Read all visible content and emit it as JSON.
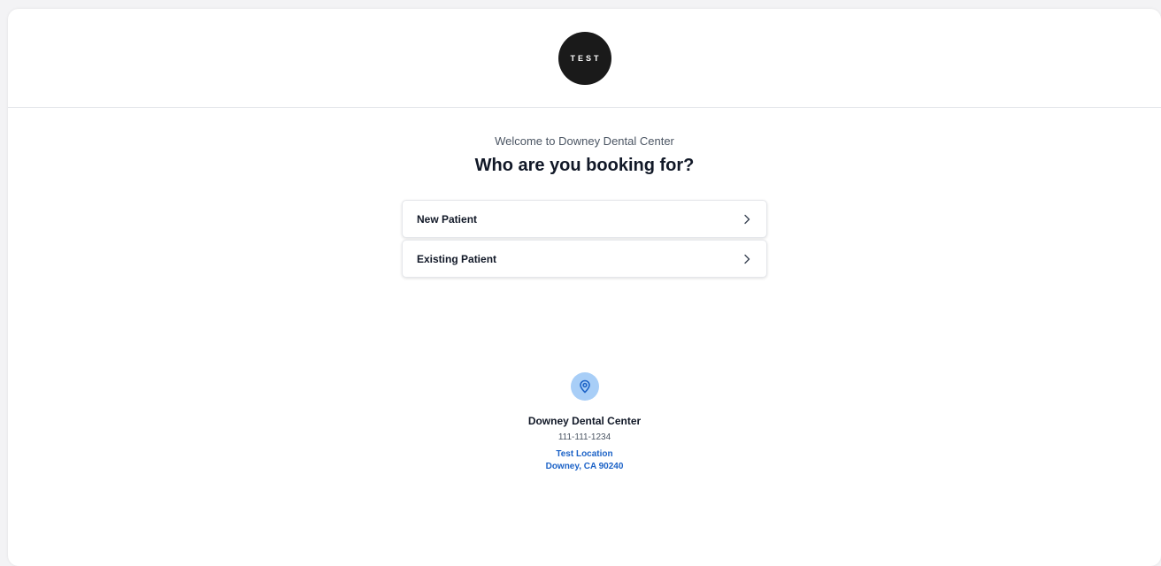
{
  "header": {
    "logo_text": "TEST"
  },
  "main": {
    "welcome": "Welcome to Downey Dental Center",
    "title": "Who are you booking for?",
    "options": [
      {
        "label": "New Patient",
        "icon": "chevron-right-icon"
      },
      {
        "label": "Existing Patient",
        "icon": "chevron-right-icon"
      }
    ]
  },
  "location": {
    "icon": "location-pin-icon",
    "name": "Downey Dental Center",
    "phone": "111-111-1234",
    "address_line1": "Test Location",
    "address_line2": "Downey, CA 90240"
  },
  "colors": {
    "logo_bg": "#1a1a1a",
    "pin_bg": "#a8cef7",
    "pin_icon": "#1d63c7",
    "link": "#1d63c7"
  }
}
